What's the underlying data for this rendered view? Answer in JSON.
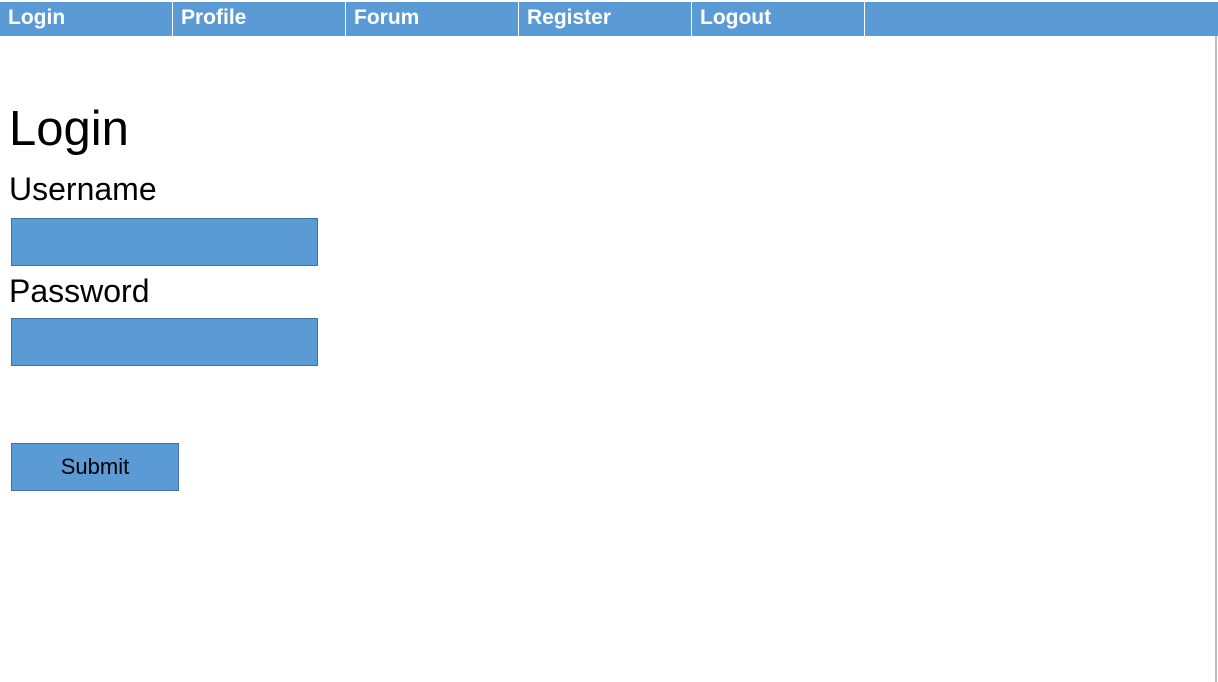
{
  "colors": {
    "accent": "#5b9bd5",
    "border": "#41719c",
    "text": "#000000",
    "nav_text": "#ffffff"
  },
  "nav": {
    "items": [
      {
        "label": "Login"
      },
      {
        "label": "Profile"
      },
      {
        "label": "Forum"
      },
      {
        "label": "Register"
      },
      {
        "label": "Logout"
      }
    ]
  },
  "main": {
    "title": "Login",
    "username": {
      "label": "Username",
      "value": "",
      "placeholder": ""
    },
    "password": {
      "label": "Password",
      "value": "",
      "placeholder": ""
    },
    "submit_label": "Submit"
  }
}
